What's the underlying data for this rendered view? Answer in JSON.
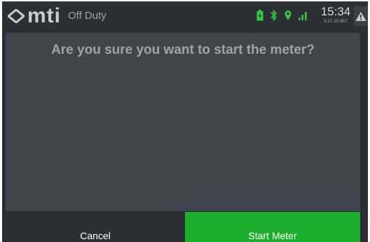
{
  "status_bar": {
    "logo_text": "mti",
    "duty_status": "Off Duty",
    "time": "15:34",
    "version": "3.27.10.957",
    "icons": [
      "battery-icon",
      "bluetooth-icon",
      "location-icon",
      "signal-icon",
      "warning-icon"
    ],
    "accent_color": "#2ecc40"
  },
  "dialog": {
    "question": "Are you sure you want to start the meter?",
    "cancel_label": "Cancel",
    "confirm_label": "Start Meter",
    "confirm_color": "#1dae2e"
  }
}
